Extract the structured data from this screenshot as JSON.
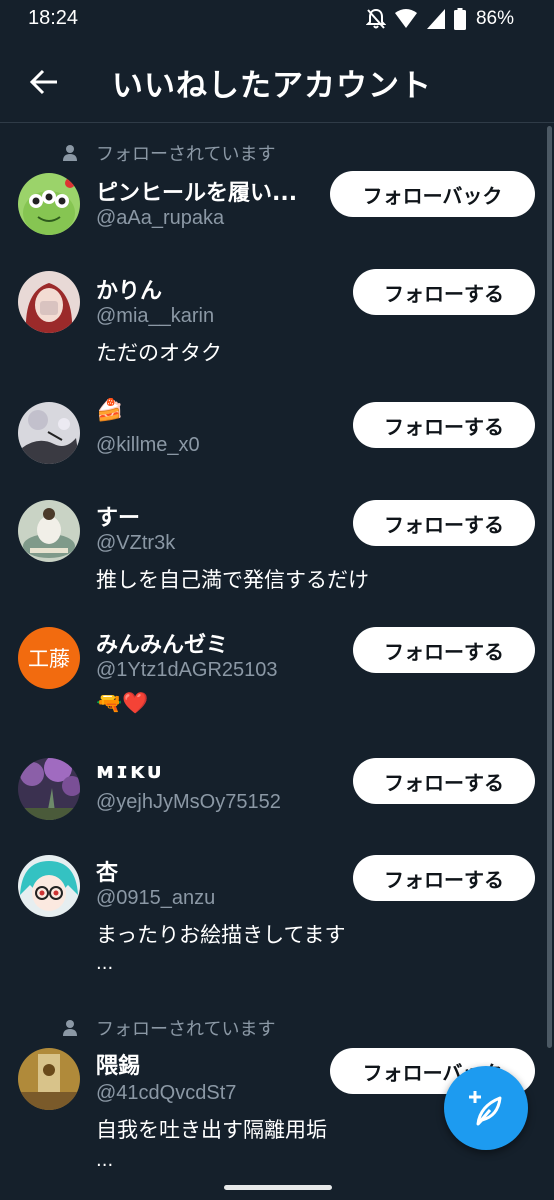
{
  "status_bar": {
    "time": "18:24",
    "battery": "86%",
    "icons": [
      "bell-off-icon",
      "wifi-icon",
      "signal-icon",
      "battery-icon"
    ]
  },
  "header": {
    "title": "いいねしたアカウント",
    "back_icon": "arrow-left-icon"
  },
  "colors": {
    "background": "#15202b",
    "muted_text": "#8b98a5",
    "button_bg": "#ffffff",
    "button_text": "#0f1419",
    "fab": "#1d9bf0"
  },
  "users": [
    {
      "follows_you": "フォローされています",
      "name": "ピンヒールを履い...",
      "handle": "@aAa_rupaka",
      "button": "フォローバック"
    },
    {
      "name": "かりん",
      "handle": "@mia__karin",
      "bio": "ただのオタク",
      "button": "フォローする"
    },
    {
      "name": "🍰",
      "handle": "@killme_x0",
      "button": "フォローする"
    },
    {
      "name": "すー",
      "handle": "@VZtr3k",
      "bio": "推しを自己満で発信するだけ",
      "button": "フォローする"
    },
    {
      "name": "みんみんゼミ",
      "handle": "@1Ytz1dAGR25103",
      "bio": "🔫❤️",
      "avatar_text": "工藤",
      "button": "フォローする"
    },
    {
      "name": "ᴍɪᴋᴜ",
      "handle": "@yejhJyMsOy75152",
      "button": "フォローする"
    },
    {
      "name": "杏",
      "handle": "@0915_anzu",
      "bio": "まったりお絵描きしてます",
      "bio_more": "...",
      "button": "フォローする"
    },
    {
      "follows_you": "フォローされています",
      "name": "隈錫",
      "handle": "@41cdQvcdSt7",
      "bio": "自我を吐き出す隔離用垢",
      "bio_more": "...",
      "button": "フォローバック"
    }
  ],
  "fab": {
    "icon": "compose-tweet-icon"
  }
}
